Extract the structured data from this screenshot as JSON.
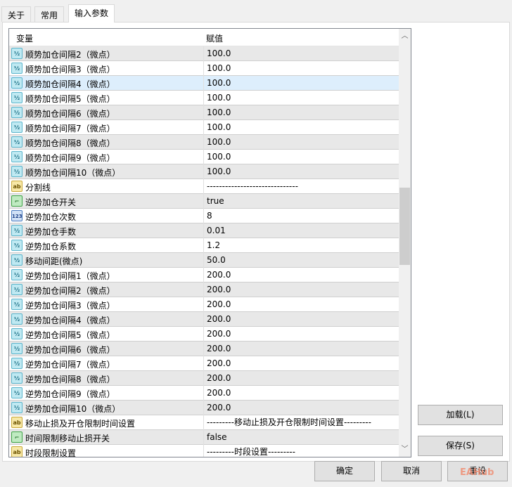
{
  "tabs": [
    "关于",
    "常用",
    "输入参数"
  ],
  "columns": {
    "name": "变量",
    "value": "赋值"
  },
  "rows": [
    {
      "type": "num",
      "name": "顺势加仓间隔2（微点）",
      "value": "100.0"
    },
    {
      "type": "num",
      "name": "顺势加仓间隔3（微点）",
      "value": "100.0"
    },
    {
      "type": "num",
      "name": "顺势加仓间隔4（微点）",
      "value": "100.0"
    },
    {
      "type": "num",
      "name": "顺势加仓间隔5（微点）",
      "value": "100.0"
    },
    {
      "type": "num",
      "name": "顺势加仓间隔6（微点）",
      "value": "100.0"
    },
    {
      "type": "num",
      "name": "顺势加仓间隔7（微点）",
      "value": "100.0"
    },
    {
      "type": "num",
      "name": "顺势加仓间隔8（微点）",
      "value": "100.0"
    },
    {
      "type": "num",
      "name": "顺势加仓间隔9（微点）",
      "value": "100.0"
    },
    {
      "type": "num",
      "name": "顺势加仓间隔10（微点）",
      "value": "100.0"
    },
    {
      "type": "str",
      "name": "分割线",
      "value": "------------------------------"
    },
    {
      "type": "bool",
      "name": "逆势加仓开关",
      "value": "true"
    },
    {
      "type": "int",
      "name": "逆势加仓次数",
      "value": "8"
    },
    {
      "type": "num",
      "name": "逆势加仓手数",
      "value": "0.01"
    },
    {
      "type": "num",
      "name": "逆势加仓系数",
      "value": "1.2"
    },
    {
      "type": "num",
      "name": "移动间距(微点)",
      "value": "50.0"
    },
    {
      "type": "num",
      "name": "逆势加仓间隔1（微点）",
      "value": "200.0"
    },
    {
      "type": "num",
      "name": "逆势加仓间隔2（微点）",
      "value": "200.0"
    },
    {
      "type": "num",
      "name": "逆势加仓间隔3（微点）",
      "value": "200.0"
    },
    {
      "type": "num",
      "name": "逆势加仓间隔4（微点）",
      "value": "200.0"
    },
    {
      "type": "num",
      "name": "逆势加仓间隔5（微点）",
      "value": "200.0"
    },
    {
      "type": "num",
      "name": "逆势加仓间隔6（微点）",
      "value": "200.0"
    },
    {
      "type": "num",
      "name": "逆势加仓间隔7（微点）",
      "value": "200.0"
    },
    {
      "type": "num",
      "name": "逆势加仓间隔8（微点）",
      "value": "200.0"
    },
    {
      "type": "num",
      "name": "逆势加仓间隔9（微点）",
      "value": "200.0"
    },
    {
      "type": "num",
      "name": "逆势加仓间隔10（微点）",
      "value": "200.0"
    },
    {
      "type": "str",
      "name": "移动止损及开仓限制时间设置",
      "value": "---------移动止损及开仓限制时间设置---------"
    },
    {
      "type": "bool",
      "name": "时间限制移动止损开关",
      "value": "false"
    },
    {
      "type": "str",
      "name": "时段限制设置",
      "value": "---------时段设置---------"
    }
  ],
  "icon_text": {
    "num": "½",
    "int": "123",
    "str": "ab",
    "bool": "⌐"
  },
  "selected_row": 2,
  "scroll_fraction": 0.45,
  "buttons": {
    "load": "加载(L)",
    "save": "保存(S)",
    "ok": "确定",
    "cancel": "取消",
    "reset": "重设"
  },
  "watermark": "EAHub"
}
